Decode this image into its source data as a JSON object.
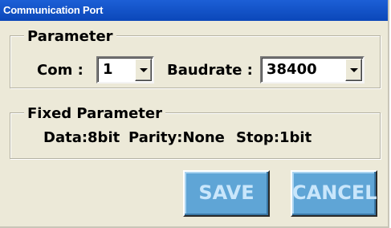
{
  "window": {
    "title": "Communication Port"
  },
  "parameter": {
    "legend": "Parameter",
    "com_label": "Com :",
    "com_value": "1",
    "baud_label": "Baudrate :",
    "baud_value": "38400"
  },
  "fixed": {
    "legend": "Fixed Parameter",
    "data": "Data:8bit",
    "parity": "Parity:None",
    "stop": "Stop:1bit"
  },
  "buttons": {
    "save": "SAVE",
    "cancel": "CANCEL"
  },
  "icons": {
    "dropdown": "chevron-down-icon"
  },
  "colors": {
    "titlebar": "#0b47b9",
    "window": "#ece9d8",
    "button": "#5fa5d6",
    "button_text": "#c9e6fb"
  }
}
